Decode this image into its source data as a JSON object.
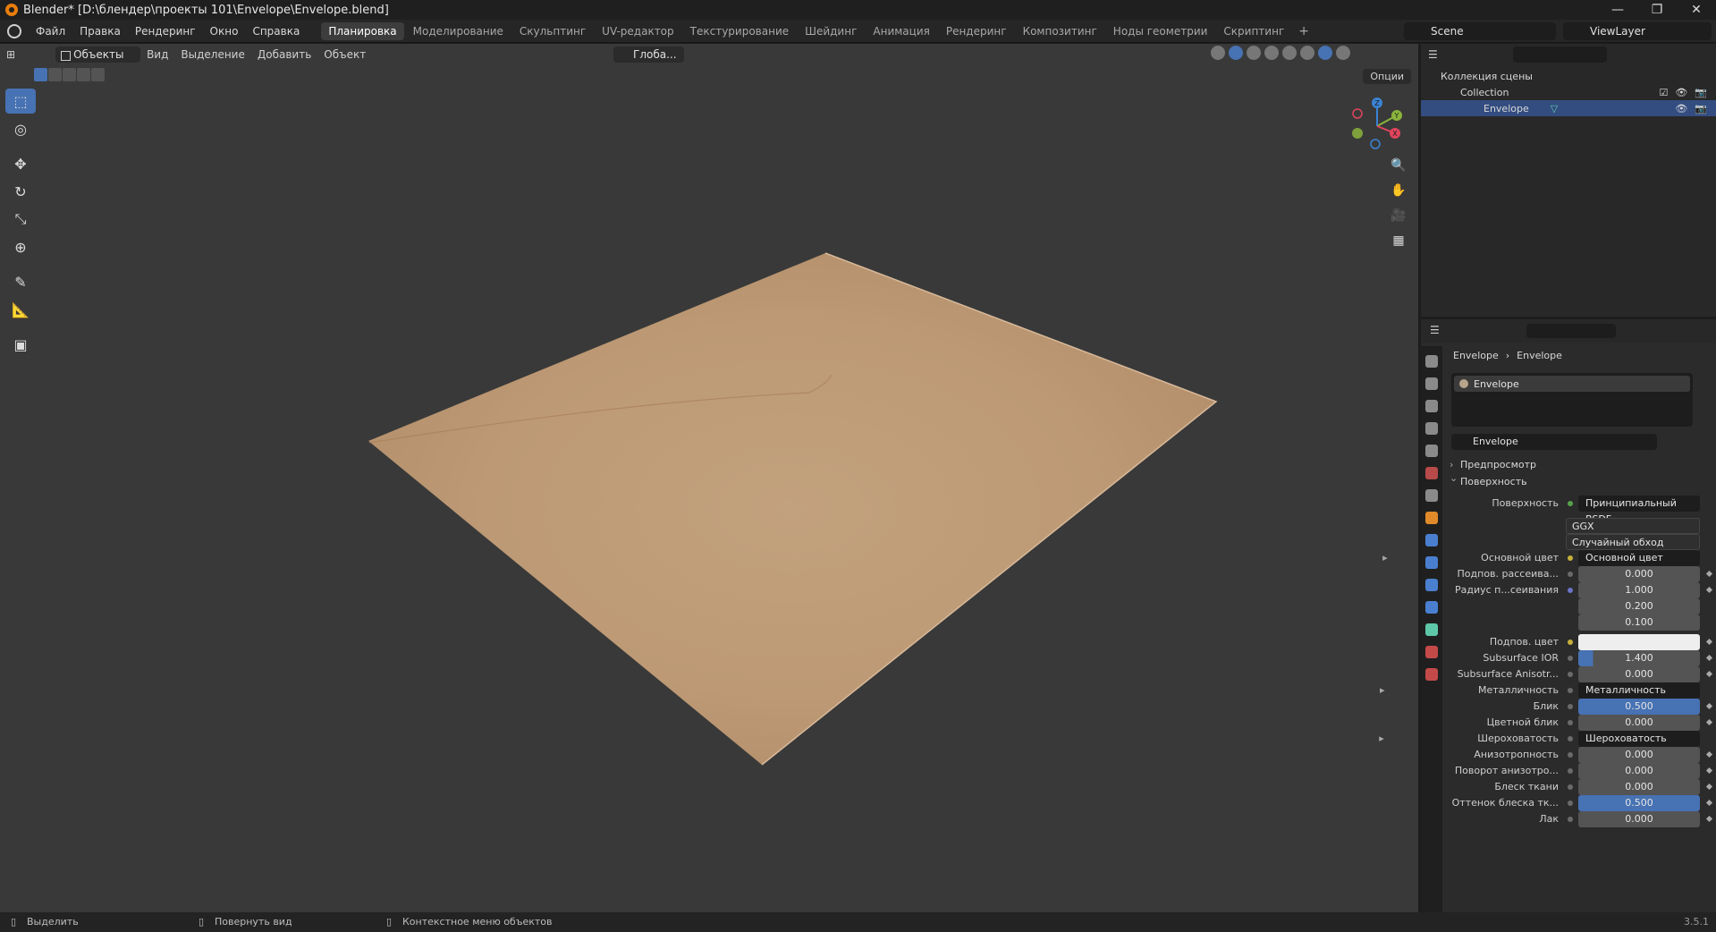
{
  "window": {
    "title": "Blender* [D:\\блендер\\проекты 101\\Envelope\\Envelope.blend]",
    "controls": [
      "—",
      "❐",
      "✕"
    ]
  },
  "menubar": {
    "menus": [
      "Файл",
      "Правка",
      "Рендеринг",
      "Окно",
      "Справка"
    ],
    "workspaces": [
      "Планировка",
      "Моделирование",
      "Скульптинг",
      "UV-редактор",
      "Текстурирование",
      "Шейдинг",
      "Анимация",
      "Рендеринг",
      "Композитинг",
      "Ноды геометрии",
      "Скриптинг"
    ],
    "active_workspace": "Планировка",
    "add_tab": "+",
    "scene": "Scene",
    "view_layer": "ViewLayer"
  },
  "viewport": {
    "mode": "Объекты",
    "menus": [
      "Вид",
      "Выделение",
      "Добавить",
      "Объект"
    ],
    "orientation": "Глоба...",
    "options": "Опции",
    "tools": [
      "select-box",
      "cursor",
      "move",
      "rotate",
      "scale",
      "transform",
      "annotate",
      "measure",
      "add-cube"
    ],
    "gizmo_axes": {
      "x": "X",
      "y": "Y",
      "z": "Z"
    },
    "colors": {
      "background": "#393939",
      "envelope": "#c09c77",
      "active": "#4772b3"
    }
  },
  "outliner": {
    "root": "Коллекция сцены",
    "collection": "Collection",
    "object": "Envelope"
  },
  "properties": {
    "breadcrumb_object": "Envelope",
    "breadcrumb_material": "Envelope",
    "slot": "Envelope",
    "material_name": "Envelope",
    "panel_preview": "Предпросмотр",
    "panel_surface": "Поверхность",
    "rows": {
      "surface_label": "Поверхность",
      "surface_value": "Принципиальный BSDF",
      "distribution": "GGX",
      "subsurface_method": "Случайный обход",
      "base_color_label": "Основной цвет",
      "base_color_value": "Основной цвет",
      "subsurface_label": "Подпов. рассеива...",
      "subsurface_value": "0.000",
      "radius_label": "Радиус п...сеивания",
      "radius_1": "1.000",
      "radius_2": "0.200",
      "radius_3": "0.100",
      "subsurface_color_label": "Подпов. цвет",
      "subsurface_ior_label": "Subsurface IOR",
      "subsurface_ior_value": "1.400",
      "subsurface_aniso_label": "Subsurface Anisotr...",
      "subsurface_aniso_value": "0.000",
      "metallic_label": "Металличность",
      "metallic_value": "Металличность",
      "specular_label": "Блик",
      "specular_value": "0.500",
      "specular_tint_label": "Цветной блик",
      "specular_tint_value": "0.000",
      "roughness_label": "Шероховатость",
      "roughness_value": "Шероховатость",
      "anisotropic_label": "Анизотропность",
      "anisotropic_value": "0.000",
      "aniso_rot_label": "Поворот анизотро...",
      "aniso_rot_value": "0.000",
      "sheen_label": "Блеск ткани",
      "sheen_value": "0.000",
      "sheen_tint_label": "Оттенок блеска тк...",
      "sheen_tint_value": "0.500",
      "clearcoat_label": "Лак",
      "clearcoat_value": "0.000"
    }
  },
  "statusbar": {
    "select": "Выделить",
    "rotate_view": "Повернуть вид",
    "context_menu": "Контекстное меню объектов",
    "version": "3.5.1"
  }
}
